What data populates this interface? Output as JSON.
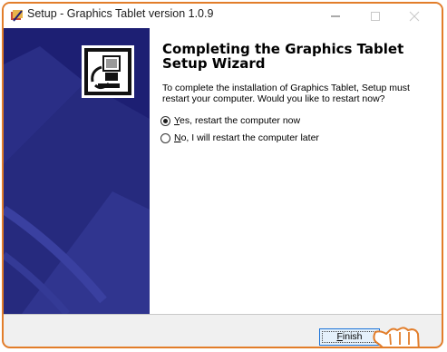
{
  "window": {
    "title": "Setup - Graphics Tablet version 1.0.9",
    "accent_color": "#e27d2a",
    "controls": [
      "minimize-icon",
      "maximize-icon",
      "close-icon"
    ]
  },
  "wizard": {
    "heading": "Completing the Graphics Tablet Setup Wizard",
    "description": "To complete the installation of Graphics Tablet, Setup must restart your computer. Would you like to restart now?",
    "options": [
      {
        "mnemonic": "Y",
        "rest": "es, restart the computer now",
        "selected": true
      },
      {
        "mnemonic": "N",
        "rest": "o, I will restart the computer later",
        "selected": false
      }
    ],
    "sidebar_color": "#1d1f73"
  },
  "footer": {
    "finish_mnemonic": "F",
    "finish_rest": "inish"
  },
  "icons": {
    "app": "setup-app-icon",
    "wizard": "computer-install-icon",
    "pointer": "hand-pointer-icon"
  }
}
